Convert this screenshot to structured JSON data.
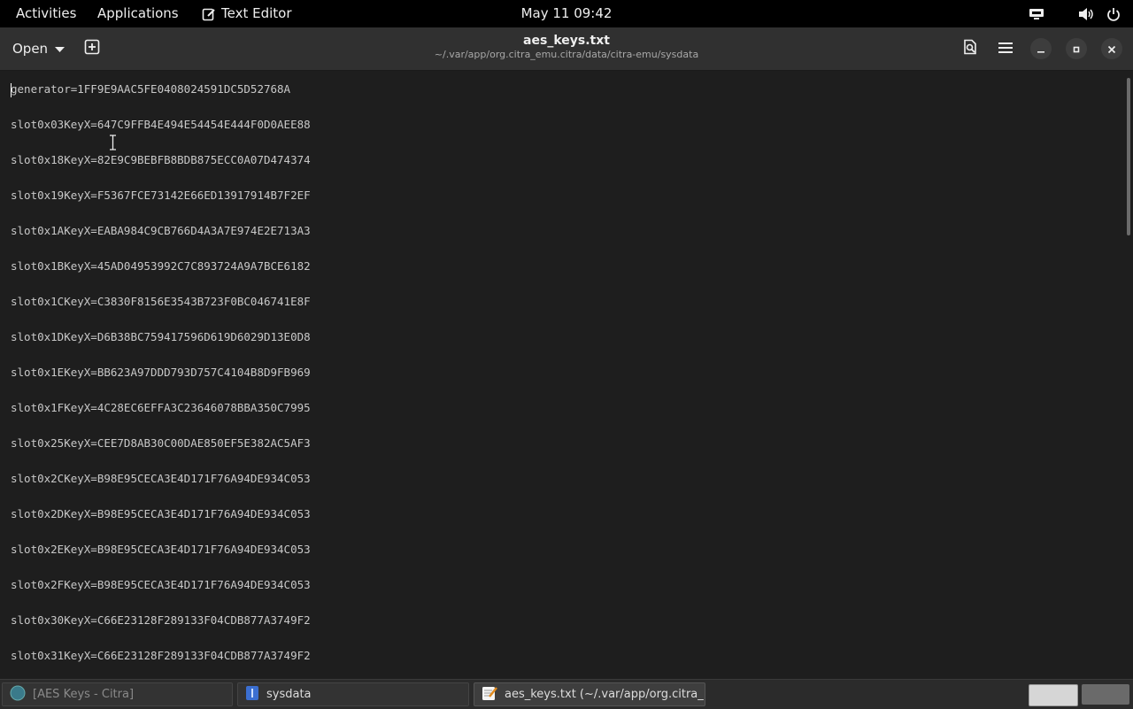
{
  "topbar": {
    "activities": "Activities",
    "applications": "Applications",
    "app_name": "Text Editor",
    "clock": "May 11  09:42"
  },
  "headerbar": {
    "open_label": "Open",
    "title": "aes_keys.txt",
    "subtitle": "~/.var/app/org.citra_emu.citra/data/citra-emu/sysdata"
  },
  "editor": {
    "lines": [
      "generator=1FF9E9AAC5FE0408024591DC5D52768A",
      "slot0x03KeyX=647C9FFB4E494E54454E444F0D0AEE88",
      "slot0x18KeyX=82E9C9BEBFB8BDB875ECC0A07D474374",
      "slot0x19KeyX=F5367FCE73142E66ED13917914B7F2EF",
      "slot0x1AKeyX=EABA984C9CB766D4A3A7E974E2E713A3",
      "slot0x1BKeyX=45AD04953992C7C893724A9A7BCE6182",
      "slot0x1CKeyX=C3830F8156E3543B723F0BC046741E8F",
      "slot0x1DKeyX=D6B38BC759417596D619D6029D13E0D8",
      "slot0x1EKeyX=BB623A97DDD793D757C4104B8D9FB969",
      "slot0x1FKeyX=4C28EC6EFFA3C23646078BBA350C7995",
      "slot0x25KeyX=CEE7D8AB30C00DAE850EF5E382AC5AF3",
      "slot0x2CKeyX=B98E95CECA3E4D171F76A94DE934C053",
      "slot0x2DKeyX=B98E95CECA3E4D171F76A94DE934C053",
      "slot0x2EKeyX=B98E95CECA3E4D171F76A94DE934C053",
      "slot0x2FKeyX=B98E95CECA3E4D171F76A94DE934C053",
      "slot0x30KeyX=C66E23128F289133F04CDB877A3749F2",
      "slot0x31KeyX=C66E23128F289133F04CDB877A3749F2"
    ]
  },
  "taskbar": {
    "items": [
      {
        "label": "[AES Keys - Citra]"
      },
      {
        "label": "sysdata"
      },
      {
        "label": "aes_keys.txt (~/.var/app/org.citra_..."
      }
    ]
  },
  "icons": {
    "text-editor": "text-editor-icon",
    "dropdown": "chevron-down-icon",
    "new-tab": "new-tab-icon",
    "search": "search-document-icon",
    "menu": "hamburger-menu-icon",
    "minimize": "minimize-icon",
    "maximize": "maximize-icon",
    "close": "close-icon"
  }
}
